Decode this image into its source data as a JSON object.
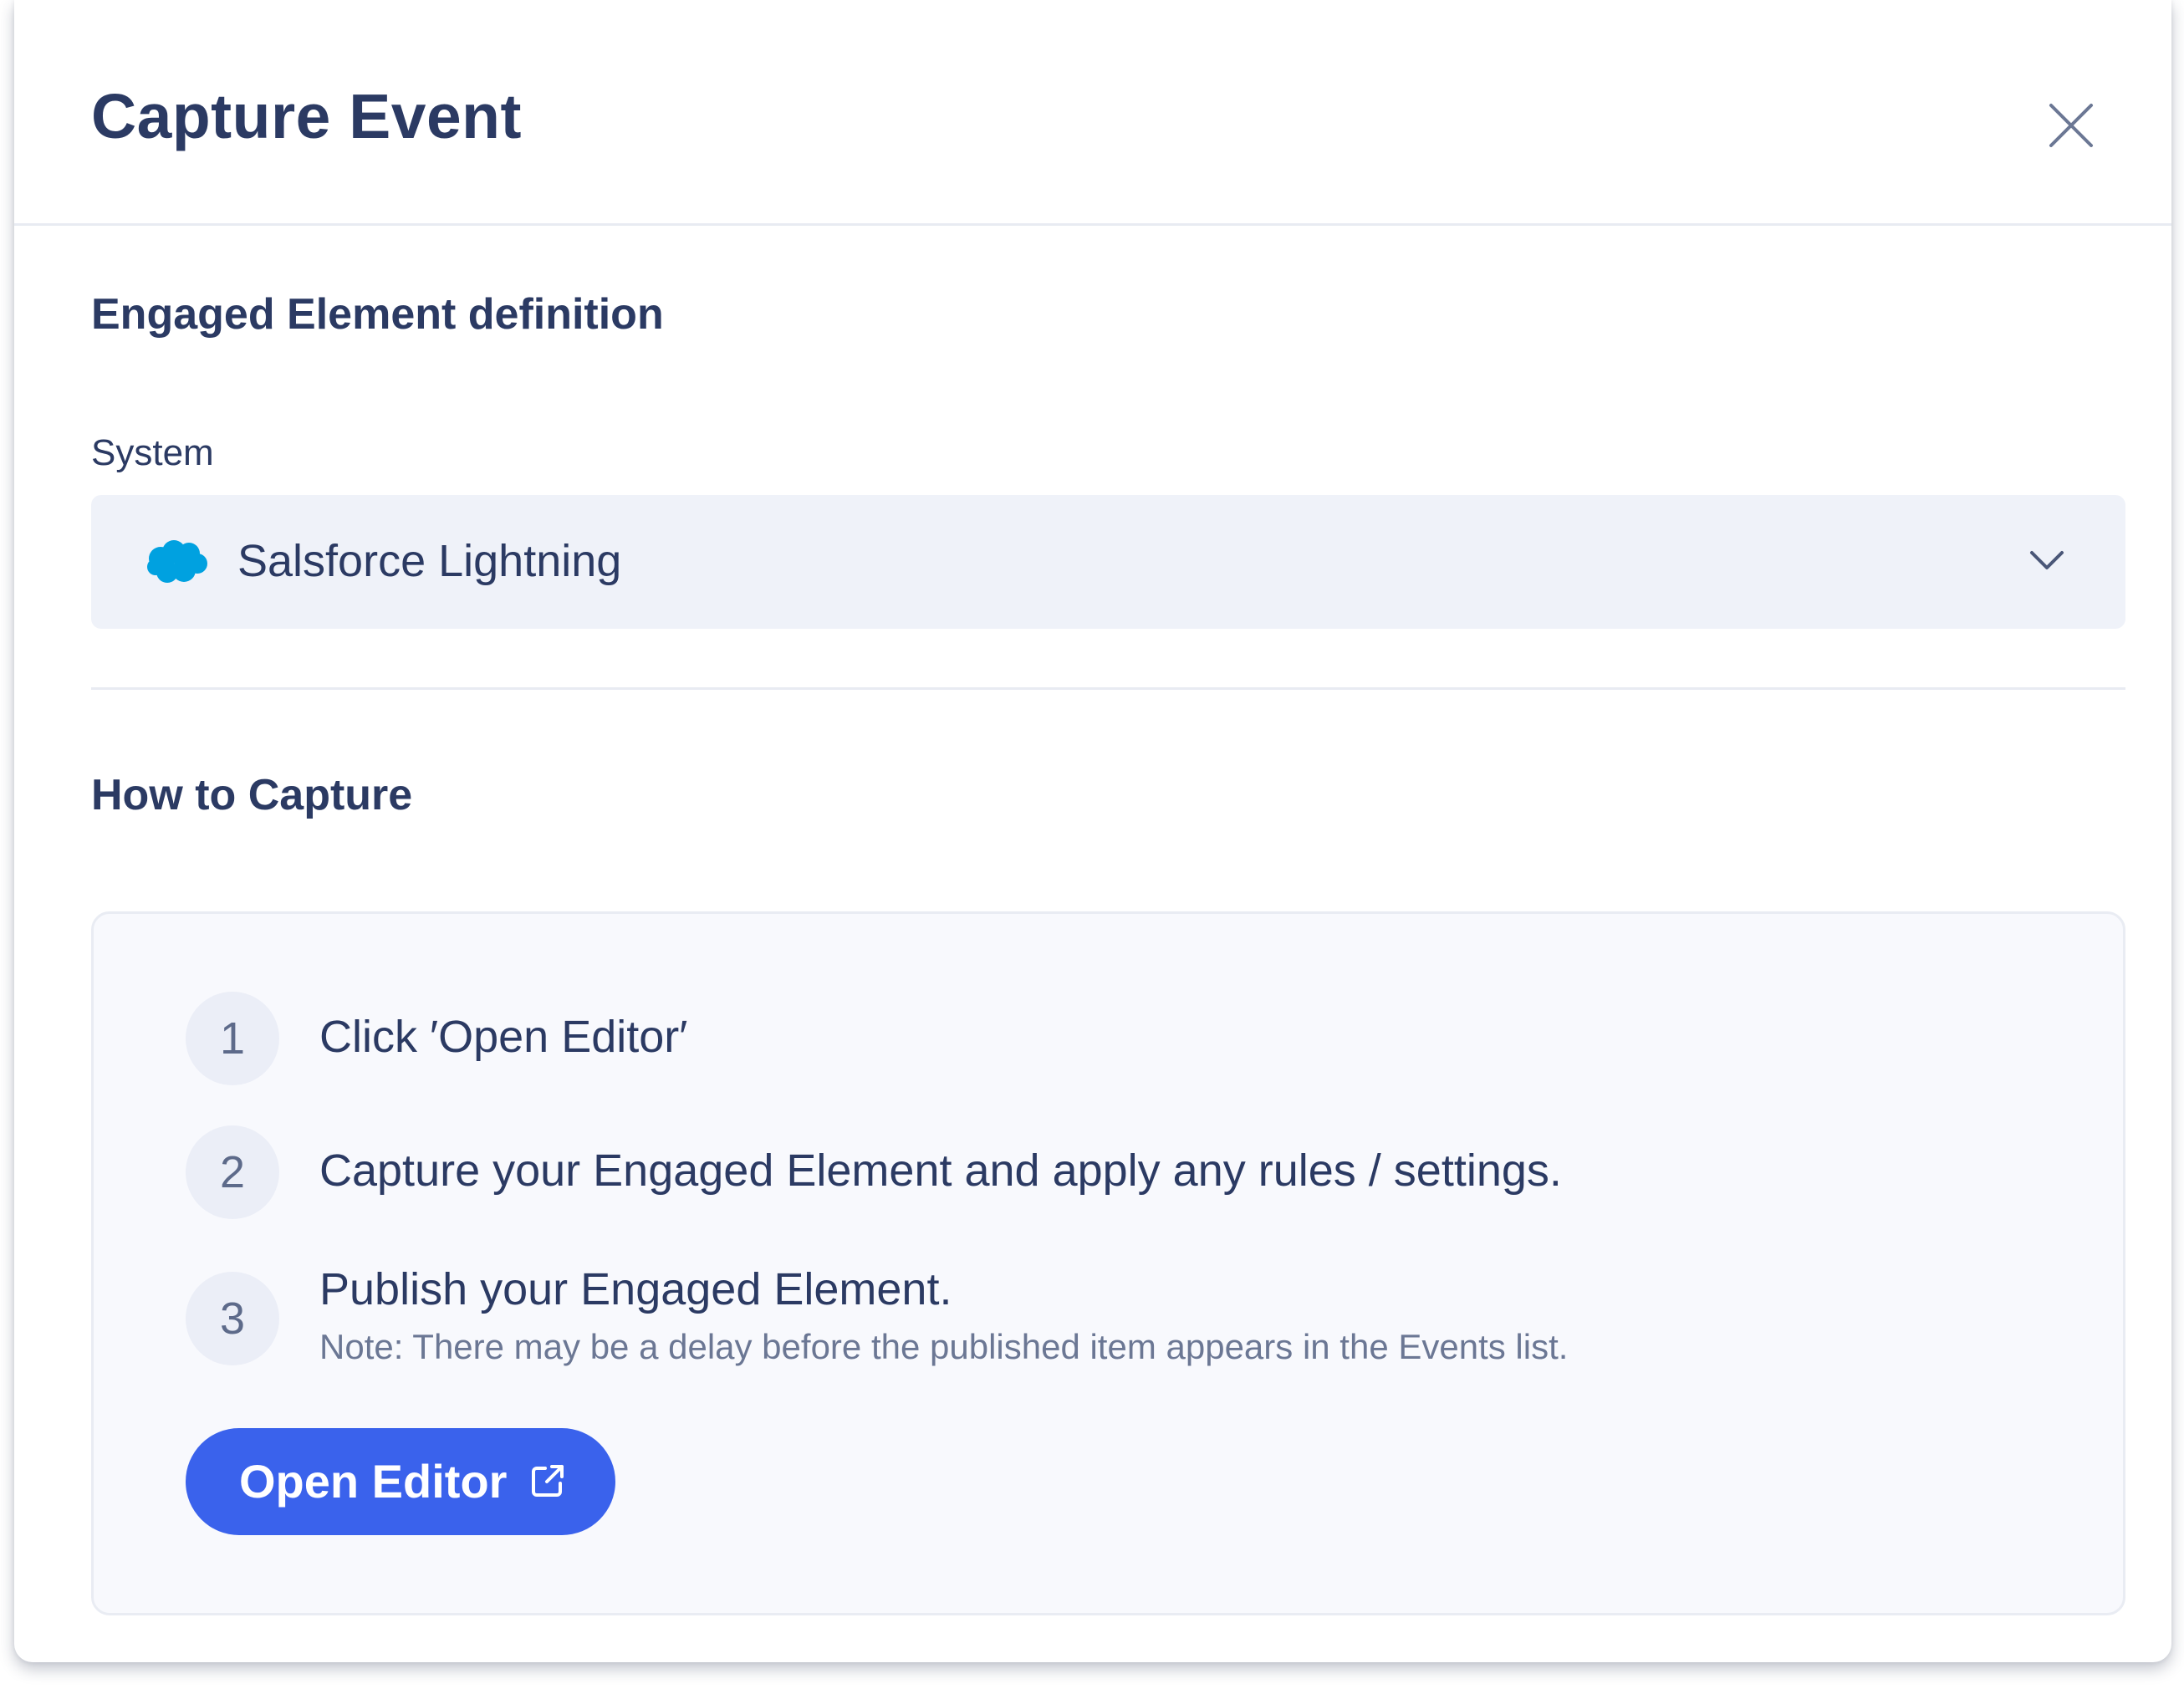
{
  "modal": {
    "title": "Capture Event",
    "close_icon": "close-icon"
  },
  "engaged_section": {
    "title": "Engaged Element definition",
    "system_label": "System",
    "system_value": "Salsforce Lightning",
    "system_logo_icon": "salesforce-cloud-icon",
    "dropdown_icon": "chevron-down-icon",
    "logo_color": "#00a1e0"
  },
  "capture_section": {
    "title": "How to Capture",
    "steps": [
      {
        "number": "1",
        "text": "Click ′Open Editor′"
      },
      {
        "number": "2",
        "text": "Capture your Engaged Element and apply any rules / settings."
      },
      {
        "number": "3",
        "text": "Publish your Engaged Element.",
        "note": "Note: There may be a delay before the published item appears in the Events list."
      }
    ],
    "open_editor_label": "Open Editor",
    "open_editor_icon": "external-link-icon",
    "button_color": "#3a62ec"
  }
}
